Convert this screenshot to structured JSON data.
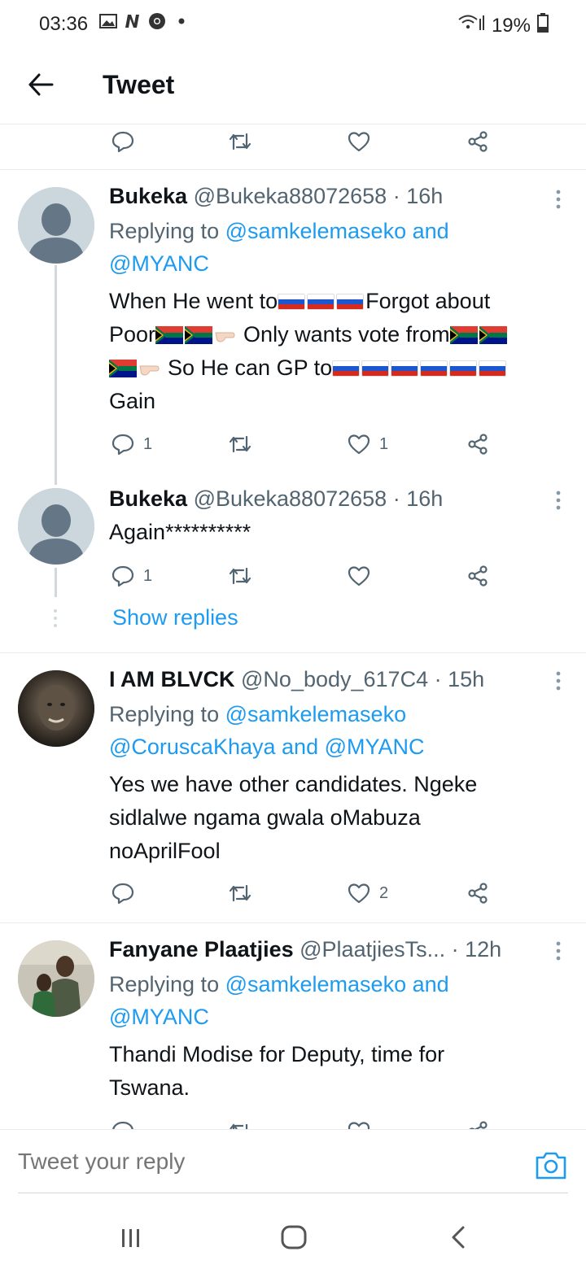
{
  "status_bar": {
    "time": "03:36",
    "battery": "19%",
    "icons": [
      "gallery-icon",
      "news-icon",
      "chrome-icon",
      "dot-icon"
    ]
  },
  "header": {
    "title": "Tweet"
  },
  "top_actions": {
    "reply_count": "",
    "like_count": ""
  },
  "tweets": [
    {
      "display_name": "Bukeka",
      "handle": "@Bukeka88072658",
      "time": "· 16h",
      "replying_prefix": "Replying to ",
      "mentions": [
        "@samkelemaseko",
        "and",
        "@MYANC"
      ],
      "text_parts": [
        "When He went to",
        "Forgot about",
        "Poor",
        "Only wants vote from",
        "So He can GP to",
        "Gain"
      ],
      "reply_count": "1",
      "like_count": "1"
    },
    {
      "display_name": "Bukeka",
      "handle": "@Bukeka88072658",
      "time": "· 16h",
      "text": "Again**********",
      "reply_count": "1",
      "like_count": ""
    },
    {
      "display_name": "I AM BLVCK",
      "handle": "@No_body_617C4",
      "time": "· 15h",
      "replying_prefix": "Replying to ",
      "mentions": [
        "@samkelemaseko",
        "@CoruscaKhaya",
        "and",
        "@MYANC"
      ],
      "text": "Yes we have other candidates. Ngeke sidlalwe ngama gwala oMabuza noAprilFool",
      "reply_count": "",
      "like_count": "2"
    },
    {
      "display_name": "Fanyane Plaatjies",
      "handle": "@PlaatjiesTs...",
      "time": "· 12h",
      "replying_prefix": "Replying to ",
      "mentions": [
        "@samkelemaseko",
        "and",
        "@MYANC"
      ],
      "text": "Thandi Modise for Deputy, time for Tswana."
    }
  ],
  "show_replies": "Show replies",
  "reply_box": {
    "placeholder": "Tweet your reply"
  },
  "colors": {
    "accent": "#1d9bf0",
    "text": "#0f1419",
    "secondary": "#536471"
  }
}
